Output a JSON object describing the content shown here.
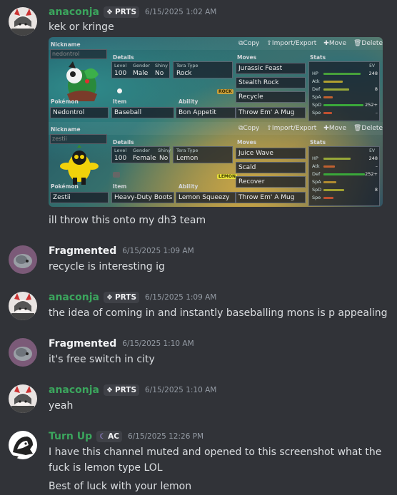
{
  "messages": [
    {
      "user": "anaconja",
      "user_color": "#3ba55d",
      "tag": "PRTS",
      "tag_icon": "diamond-dots-icon",
      "time": "6/15/2025 1:02 AM",
      "lines": [
        "kek or kringe"
      ],
      "after_lines": [
        "ill throw this onto my dh3 team"
      ]
    },
    {
      "user": "Fragmented",
      "user_color": "#f2f3f5",
      "time": "6/15/2025 1:09 AM",
      "lines": [
        "recycle is interesting ig"
      ]
    },
    {
      "user": "anaconja",
      "user_color": "#3ba55d",
      "tag": "PRTS",
      "time": "6/15/2025 1:09 AM",
      "lines": [
        "the idea of coming in and instantly baseballing mons is p appealing"
      ]
    },
    {
      "user": "Fragmented",
      "user_color": "#f2f3f5",
      "time": "6/15/2025 1:10 AM",
      "lines": [
        "it's free switch in city"
      ]
    },
    {
      "user": "anaconja",
      "user_color": "#3ba55d",
      "tag": "PRTS",
      "time": "6/15/2025 1:10 AM",
      "lines": [
        "yeah"
      ]
    },
    {
      "user": "Turn Up",
      "user_color": "#3ba55d",
      "tag": "AC",
      "tag_icon": "moon-icon",
      "time": "6/15/2025 12:26 PM",
      "lines": [
        "I have this channel muted and opened to this screenshot what the",
        "fuck is lemon type LOL",
        "Best of luck with your lemon"
      ]
    }
  ],
  "screenshot": {
    "toolbar": {
      "copy": "Copy",
      "import_export": "Import/Export",
      "move": "Move",
      "delete": "Delete"
    },
    "labels": {
      "nickname": "Nickname",
      "details": "Details",
      "moves": "Moves",
      "stats": "Stats",
      "level": "Level",
      "gender": "Gender",
      "shiny": "Shiny",
      "tera_type": "Tera Type",
      "pokemon": "Pokémon",
      "item": "Item",
      "ability": "Ability",
      "ev": "EV"
    },
    "pokemon": [
      {
        "nickname": "nedontrol",
        "level": "100",
        "gender": "Male",
        "shiny": "No",
        "tera": "Rock",
        "tera_badge": "ROCK",
        "tera_color": "#c8a03c",
        "species": "Nedontrol",
        "item": "Baseball",
        "ability": "Bon Appetit",
        "moves": [
          "Jurassic Feast",
          "Stealth Rock",
          "Recycle",
          "Throw Em' A Mug"
        ],
        "stats": [
          {
            "name": "HP",
            "ev": "248",
            "bar": 0.72
          },
          {
            "name": "Atk",
            "ev": "",
            "bar": 0.38
          },
          {
            "name": "Def",
            "ev": "8",
            "bar": 0.5
          },
          {
            "name": "SpA",
            "ev": "",
            "bar": 0.18
          },
          {
            "name": "SpD",
            "ev": "252+",
            "bar": 0.78
          },
          {
            "name": "Spe",
            "ev": "–",
            "bar": 0.16
          }
        ]
      },
      {
        "nickname": "zestii",
        "level": "100",
        "gender": "Female",
        "shiny": "No",
        "tera": "Lemon",
        "tera_badge": "LEMON",
        "tera_color": "#e8e03a",
        "species": "Zestii",
        "item": "Heavy-Duty Boots",
        "ability": "Lemon Squeezy",
        "moves": [
          "Juice Wave",
          "Scald",
          "Recover",
          "Throw Em' A Mug"
        ],
        "stats": [
          {
            "name": "HP",
            "ev": "248",
            "bar": 0.52
          },
          {
            "name": "Atk",
            "ev": "–",
            "bar": 0.22
          },
          {
            "name": "Def",
            "ev": "252+",
            "bar": 0.8
          },
          {
            "name": "SpA",
            "ev": "",
            "bar": 0.25
          },
          {
            "name": "SpD",
            "ev": "8",
            "bar": 0.4
          },
          {
            "name": "Spe",
            "ev": "",
            "bar": 0.2
          }
        ]
      }
    ]
  },
  "colors": {
    "background": "#313338",
    "green_user": "#3ba55d",
    "muted": "#949ba4"
  }
}
